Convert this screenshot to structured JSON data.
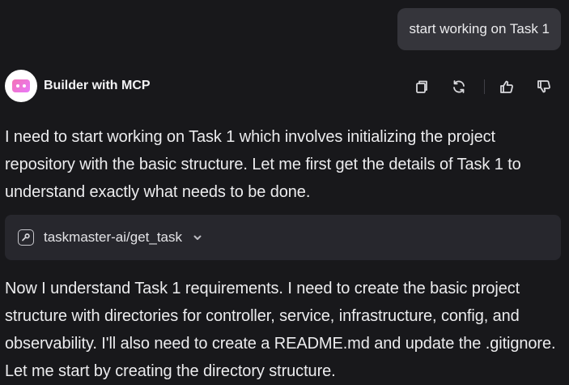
{
  "user_message": "start working on Task 1",
  "agent": {
    "name": "Builder with MCP",
    "avatar_icon": "robot-icon"
  },
  "actions": {
    "copy_icon": "copy-icon",
    "regenerate_icon": "refresh-icon",
    "like_icon": "thumbs-up-icon",
    "dislike_icon": "thumbs-down-icon"
  },
  "messages": [
    "I need to start working on Task 1 which involves initializing the project repository with the basic structure. Let me first get the details of Task 1 to understand exactly what needs to be done.",
    "Now I understand Task 1 requirements. I need to create the basic project structure with directories for controller, service, infrastructure, config, and observability. I'll also need to create a README.md and update the .gitignore. Let me start by creating the directory structure."
  ],
  "tool_call": {
    "label": "taskmaster-ai/get_task",
    "icon": "tool-icon",
    "expand_icon": "chevron-down-icon"
  },
  "colors": {
    "background": "#18181b",
    "user_bubble": "#35353b",
    "tool_call_bg": "#27272d",
    "text": "#ececee"
  }
}
